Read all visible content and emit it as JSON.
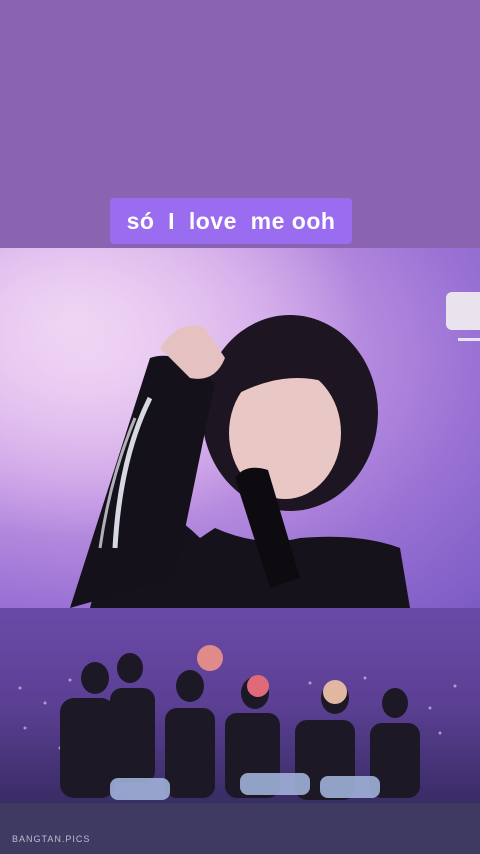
{
  "caption": {
    "text": "só  I  love  me ooh"
  },
  "watermark": {
    "text": "BANGTAN.PICS"
  },
  "icons": {
    "side_button": "side-tab-icon"
  }
}
